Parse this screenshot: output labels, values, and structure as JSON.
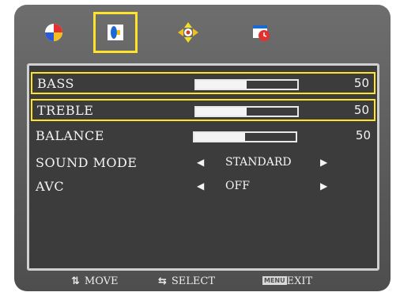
{
  "tabs": [
    {
      "icon": "picture-icon",
      "active": false
    },
    {
      "icon": "sound-icon",
      "active": true
    },
    {
      "icon": "setup-icon",
      "active": false
    },
    {
      "icon": "time-icon",
      "active": false
    }
  ],
  "rows": [
    {
      "label": "BASS",
      "type": "slider",
      "value": "50",
      "level": 0.5,
      "highlighted": true
    },
    {
      "label": "TREBLE",
      "type": "slider",
      "value": "50",
      "level": 0.5,
      "highlighted": true
    },
    {
      "label": "BALANCE",
      "type": "slider",
      "value": "50",
      "level": 0.5,
      "highlighted": false
    },
    {
      "label": "SOUND MODE",
      "type": "select",
      "option": "STANDARD"
    },
    {
      "label": "AVC",
      "type": "select",
      "option": "OFF"
    }
  ],
  "footer": {
    "move": "MOVE",
    "select": "SELECT",
    "menu_icon": "MENU",
    "exit": "EXIT"
  },
  "colors": {
    "highlight": "#ffe22a",
    "panel": "#3c3c3c",
    "frame": "#5e5e5e"
  }
}
